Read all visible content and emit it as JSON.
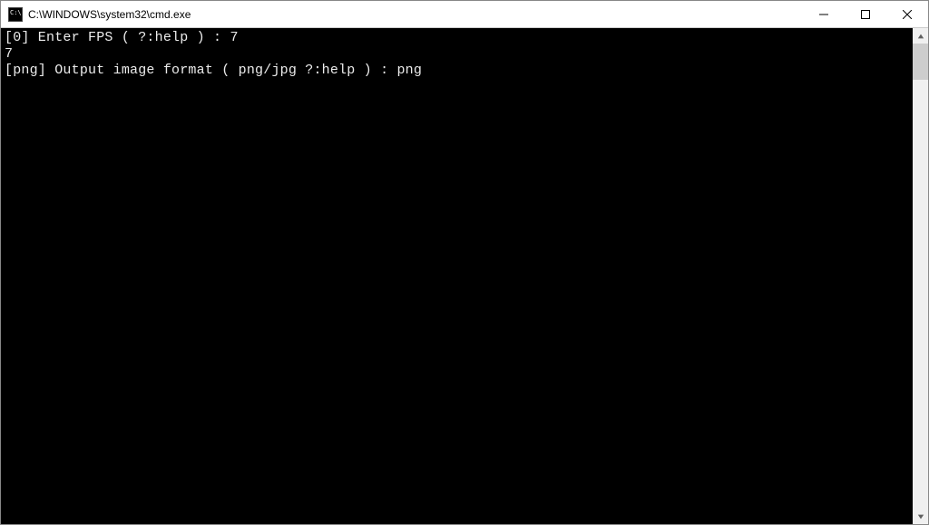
{
  "window": {
    "title": "C:\\WINDOWS\\system32\\cmd.exe"
  },
  "terminal": {
    "lines": [
      "[0] Enter FPS ( ?:help ) : 7",
      "7",
      "[png] Output image format ( png/jpg ?:help ) : png"
    ]
  }
}
